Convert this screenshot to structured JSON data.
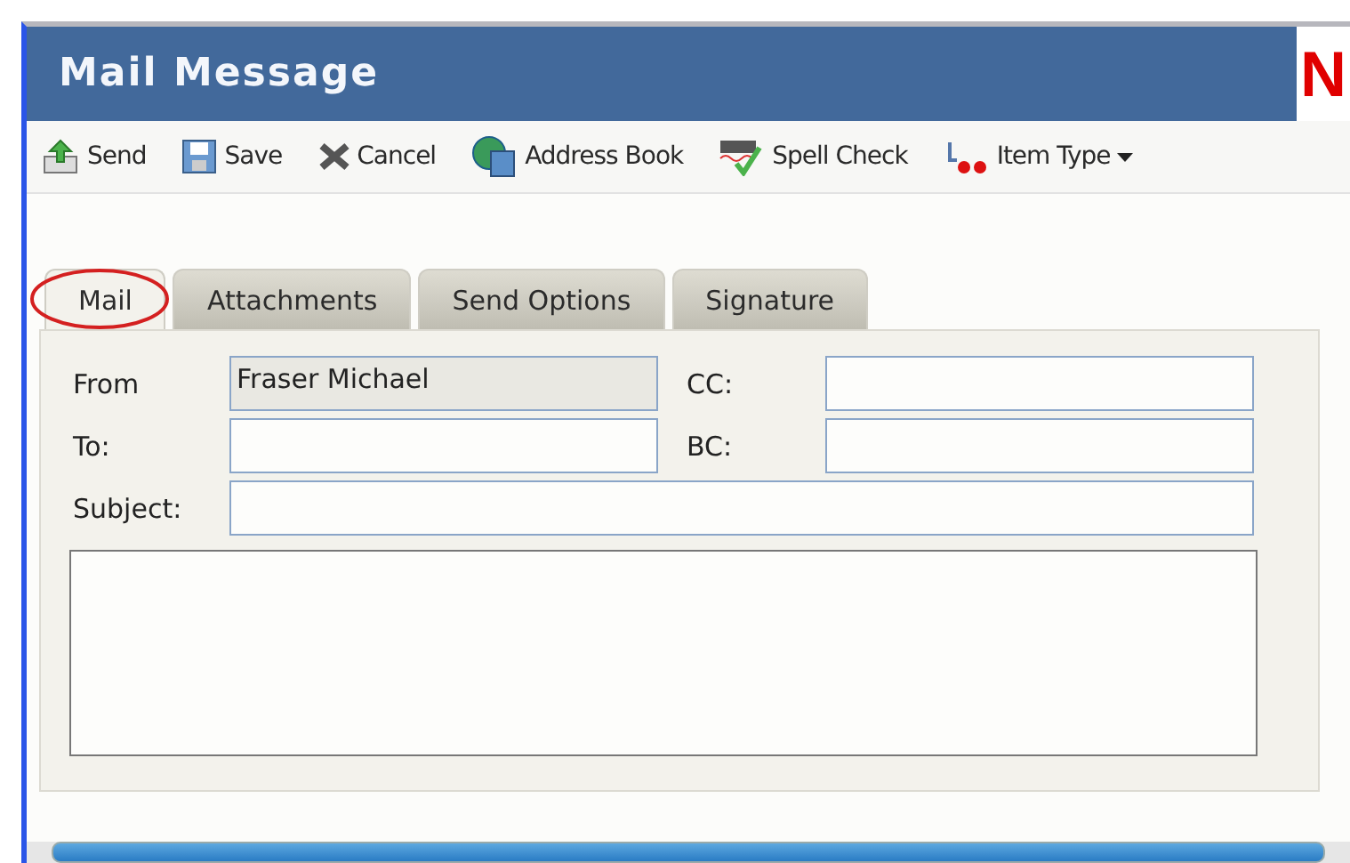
{
  "window": {
    "title": "Mail Message",
    "logo": "N"
  },
  "toolbar": [
    {
      "label": "Send",
      "dropdown": false
    },
    {
      "label": "Save",
      "dropdown": false
    },
    {
      "label": "Cancel",
      "dropdown": false
    },
    {
      "label": "Address Book",
      "dropdown": false
    },
    {
      "label": "Spell Check",
      "dropdown": false
    },
    {
      "label": "Item Type",
      "dropdown": true
    }
  ],
  "tabs": [
    {
      "label": "Mail",
      "selected": true,
      "circled": true
    },
    {
      "label": "Attachments",
      "selected": false,
      "circled": false
    },
    {
      "label": "Send Options",
      "selected": false,
      "circled": false
    },
    {
      "label": "Signature",
      "selected": false,
      "circled": false
    }
  ],
  "form": {
    "from": {
      "label": "From",
      "value": "Fraser Michael",
      "disabled": true
    },
    "to": {
      "label": "To:"
    },
    "cc": {
      "label": "CC:"
    },
    "bc": {
      "label": "BC:"
    },
    "subject": {
      "label": "Subject:"
    }
  }
}
